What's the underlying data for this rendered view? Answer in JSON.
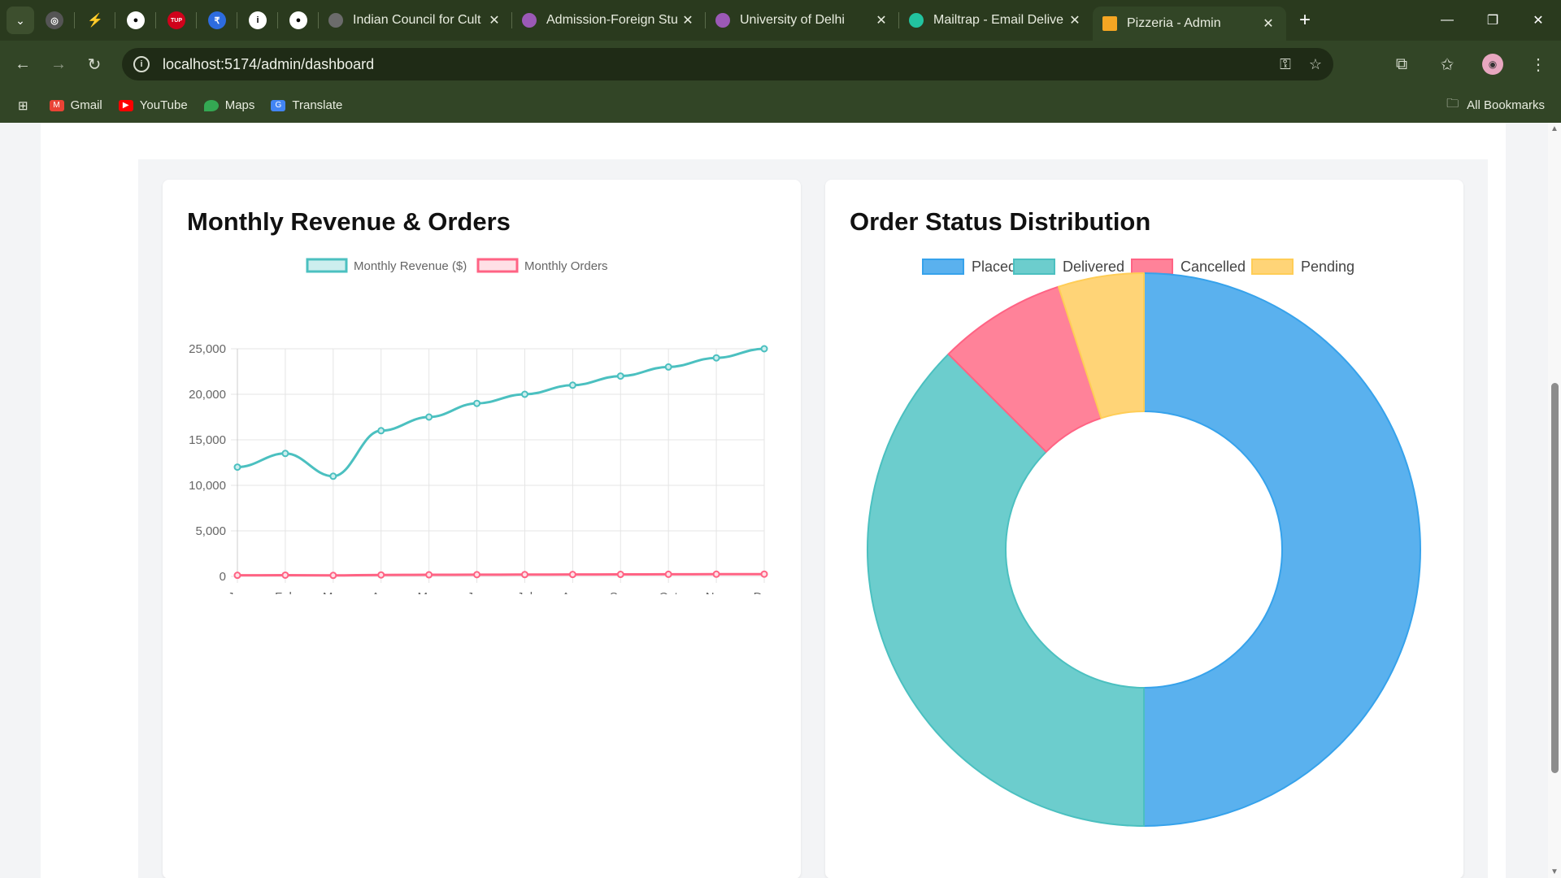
{
  "browser": {
    "tabs": [
      {
        "label": "Indian Council for Cult",
        "favicon_color": "#6b6b6b"
      },
      {
        "label": "Admission-Foreign Stu",
        "favicon_color": "#9b59b6"
      },
      {
        "label": "University of Delhi",
        "favicon_color": "#9b59b6"
      },
      {
        "label": "Mailtrap - Email Delive",
        "favicon_color": "#22c3a0"
      },
      {
        "label": "Pizzeria - Admin",
        "favicon_color": "#f5a623"
      }
    ],
    "url": "localhost:5174/admin/dashboard",
    "bookmarks": [
      {
        "label": "Gmail",
        "icon": "gmail-icon"
      },
      {
        "label": "YouTube",
        "icon": "youtube-icon"
      },
      {
        "label": "Maps",
        "icon": "maps-icon"
      },
      {
        "label": "Translate",
        "icon": "translate-icon"
      }
    ],
    "all_bookmarks": "All Bookmarks"
  },
  "cards": {
    "revenue_title": "Monthly Revenue & Orders",
    "status_title": "Order Status Distribution"
  },
  "chart_data": [
    {
      "type": "line",
      "title": "Monthly Revenue & Orders",
      "categories": [
        "Jan",
        "Feb",
        "Mar",
        "Apr",
        "May",
        "Jun",
        "Jul",
        "Aug",
        "Sep",
        "Oct",
        "Nov",
        "Dec"
      ],
      "series": [
        {
          "name": "Monthly Revenue ($)",
          "color": "#4bc0c0",
          "values": [
            12000,
            13500,
            11000,
            16000,
            17500,
            19000,
            20000,
            21000,
            22000,
            23000,
            24000,
            25000
          ]
        },
        {
          "name": "Monthly Orders",
          "color": "#ff6384",
          "values": [
            120,
            135,
            110,
            160,
            175,
            190,
            200,
            210,
            220,
            230,
            240,
            250
          ]
        }
      ],
      "yticks": [
        "0",
        "5,000",
        "10,000",
        "15,000",
        "20,000",
        "25,000"
      ],
      "ylim": [
        0,
        25000
      ],
      "grid": true,
      "legend": "top"
    },
    {
      "type": "pie",
      "title": "Order Status Distribution",
      "labels": [
        "Placed",
        "Delivered",
        "Cancelled",
        "Pending"
      ],
      "values": [
        50,
        37.5,
        7.5,
        5
      ],
      "colors": [
        "#5ab1ee",
        "#6ccdcd",
        "#ff8299",
        "#ffd477"
      ],
      "borders": [
        "#36a2eb",
        "#4bc0c0",
        "#ff6384",
        "#ffcd56"
      ],
      "legend": "top"
    }
  ]
}
